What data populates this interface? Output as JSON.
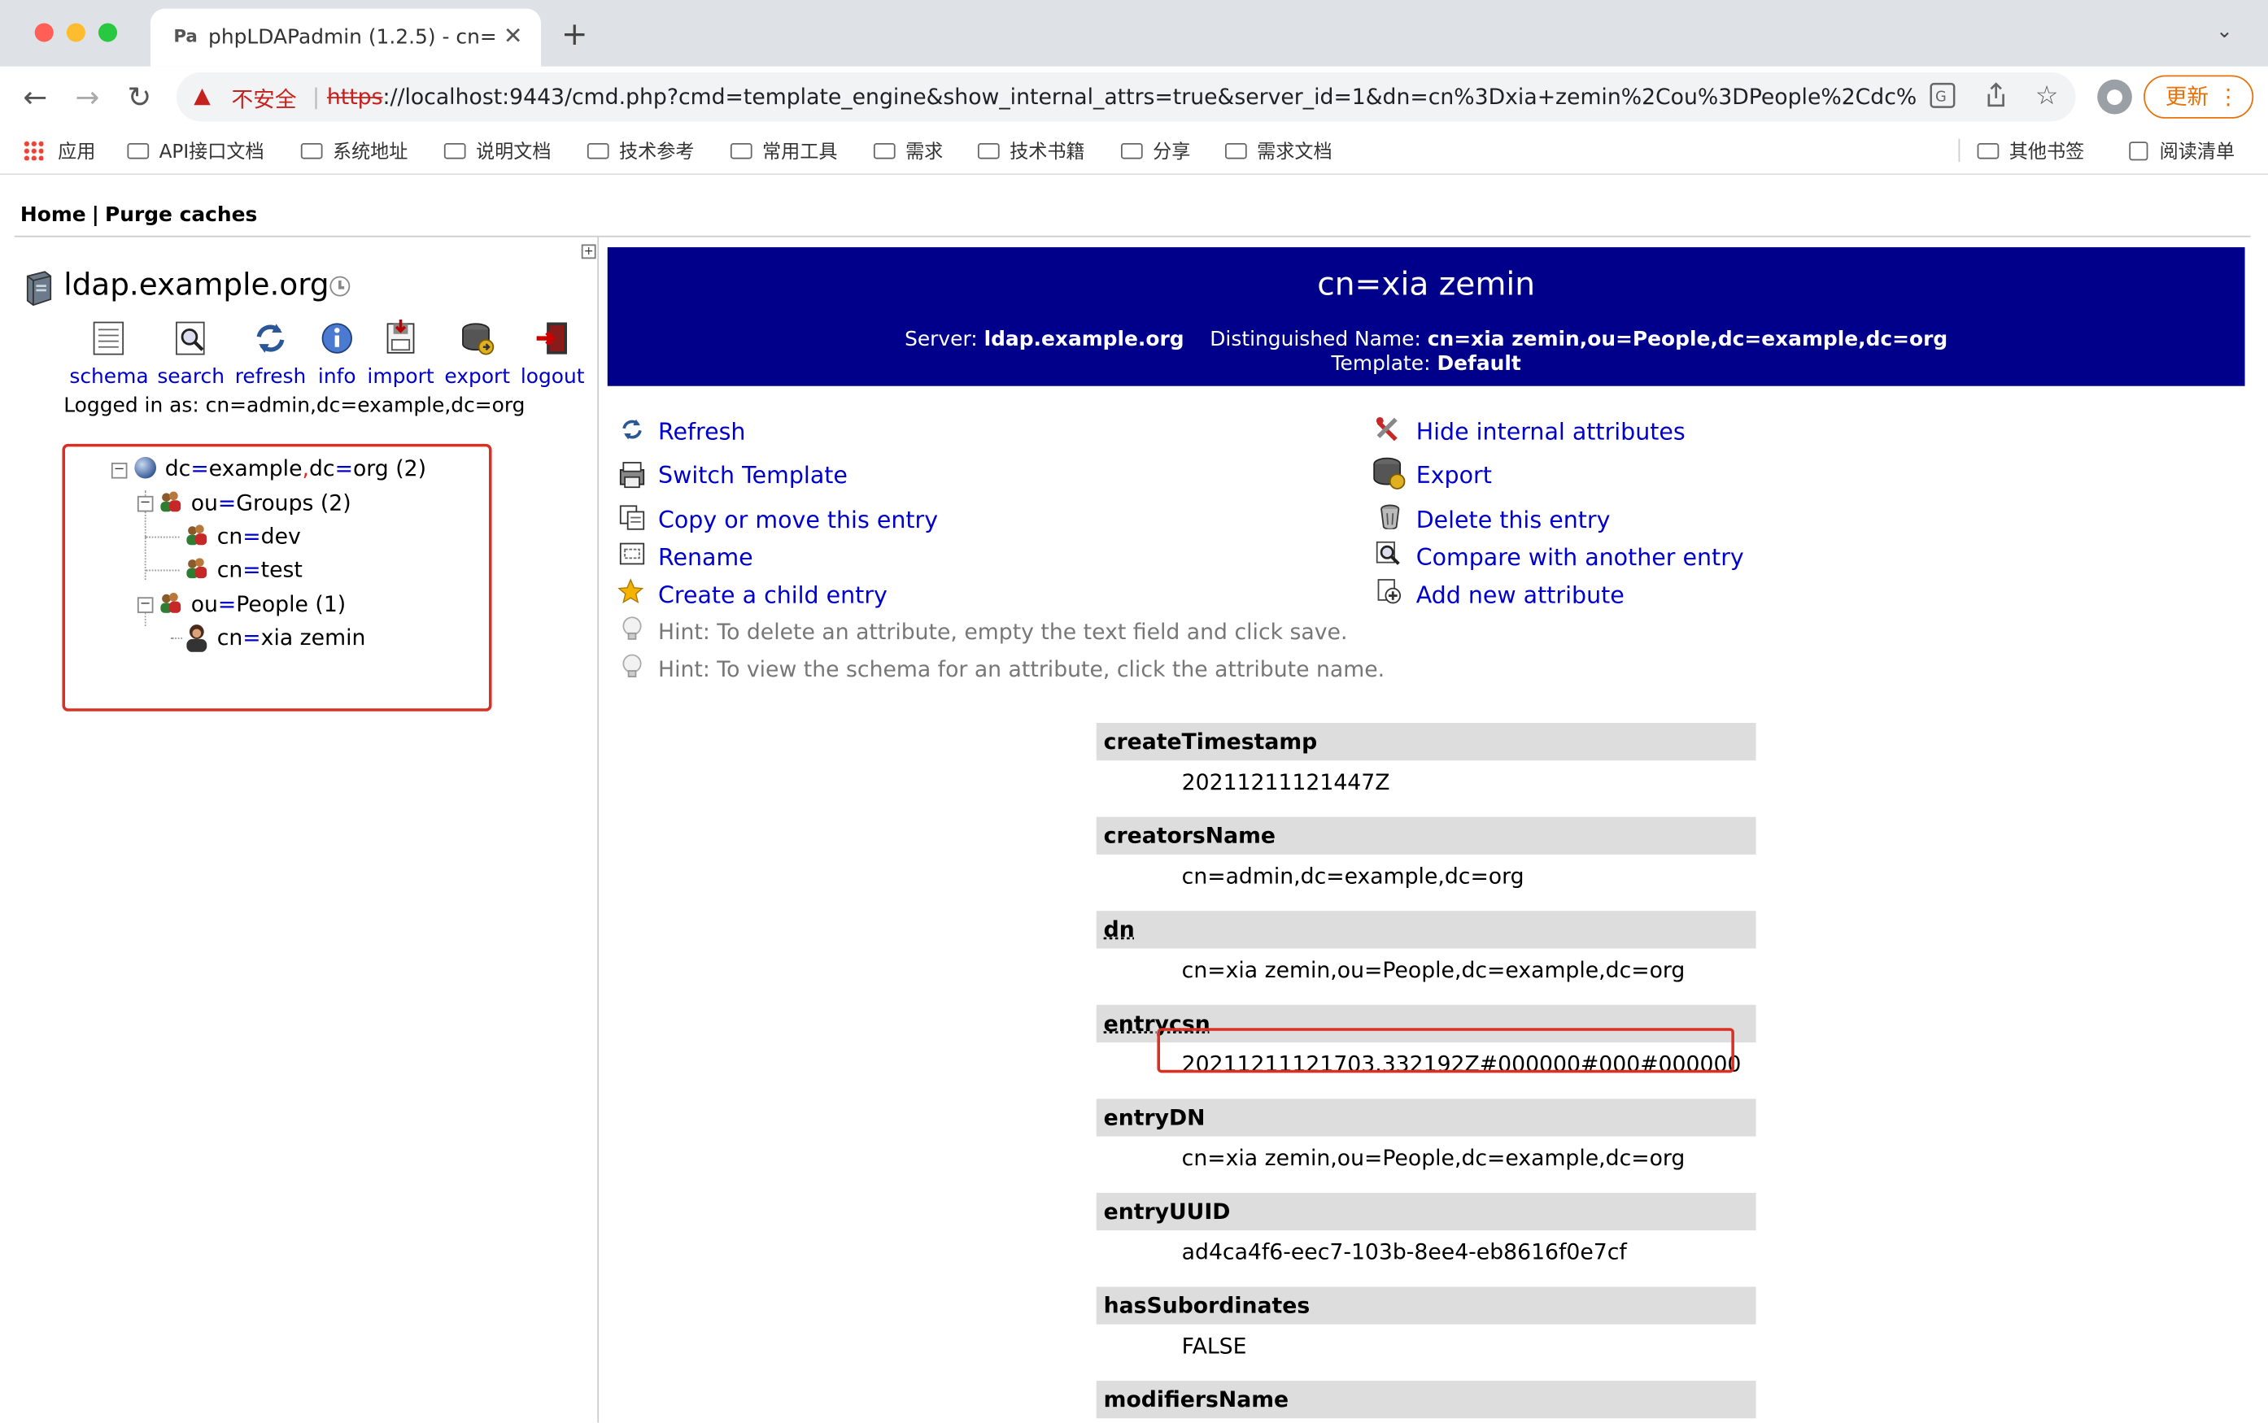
{
  "browser": {
    "tab_title": "phpLDAPadmin (1.2.5) - cn=xia zemin",
    "favicon_text": "Pa",
    "new_tab": "+",
    "security_label": "不安全",
    "url_scheme": "https",
    "url_rest": "://localhost:9443/cmd.php?cmd=template_engine&show_internal_attrs=true&server_id=1&dn=cn%3Dxia+zemin%2Cou%3DPeople%2Cdc%...",
    "update_label": "更新",
    "bookmarks": [
      "应用",
      "API接口文档",
      "系统地址",
      "说明文档",
      "技术参考",
      "常用工具",
      "需求",
      "技术书籍",
      "分享",
      "需求文档"
    ],
    "bookmarks_right": [
      "其他书签",
      "阅读清单"
    ]
  },
  "nav": {
    "home": "Home",
    "separator": "|",
    "purge": "Purge caches"
  },
  "server": {
    "name": "ldap.example.org",
    "tools": [
      "schema",
      "search",
      "refresh",
      "info",
      "import",
      "export",
      "logout"
    ],
    "logged_in": "Logged in as: cn=admin,dc=example,dc=org"
  },
  "tree": {
    "root": {
      "attr": "dc",
      "val": "example",
      "attr2": "dc",
      "val2": "org",
      "count": "(2)"
    },
    "groups": {
      "attr": "ou",
      "val": "Groups",
      "count": "(2)"
    },
    "dev": {
      "attr": "cn",
      "val": "dev"
    },
    "test": {
      "attr": "cn",
      "val": "test"
    },
    "people": {
      "attr": "ou",
      "val": "People",
      "count": "(1)"
    },
    "person": {
      "attr": "cn",
      "val": "xia zemin"
    }
  },
  "entry": {
    "title": "cn=xia zemin",
    "server_label": "Server:",
    "server_value": "ldap.example.org",
    "dn_label": "Distinguished Name:",
    "dn_value": "cn=xia zemin,ou=People,dc=example,dc=org",
    "template_label": "Template:",
    "template_value": "Default"
  },
  "actions_left": [
    "Refresh",
    "Switch Template",
    "Copy or move this entry",
    "Rename",
    "Create a child entry"
  ],
  "actions_right": [
    "Hide internal attributes",
    "Export",
    "Delete this entry",
    "Compare with another entry",
    "Add new attribute"
  ],
  "hints": [
    "Hint: To delete an attribute, empty the text field and click save.",
    "Hint: To view the schema for an attribute, click the attribute name."
  ],
  "attributes": [
    {
      "name": "createTimestamp",
      "value": "20211211121447Z"
    },
    {
      "name": "creatorsName",
      "value": "cn=admin,dc=example,dc=org"
    },
    {
      "name": "dn",
      "value": "cn=xia zemin,ou=People,dc=example,dc=org"
    },
    {
      "name": "entrycsn",
      "value": "20211211121703.332192Z#000000#000#000000"
    },
    {
      "name": "entryDN",
      "value": "cn=xia zemin,ou=People,dc=example,dc=org"
    },
    {
      "name": "entryUUID",
      "value": "ad4ca4f6-eec7-103b-8ee4-eb8616f0e7cf"
    },
    {
      "name": "hasSubordinates",
      "value": "FALSE"
    },
    {
      "name": "modifiersName",
      "value": ""
    }
  ],
  "colors": {
    "header_bg": "#00008b",
    "link": "#0000cc",
    "highlight": "#d93025",
    "attr_bg": "#dddddd"
  }
}
